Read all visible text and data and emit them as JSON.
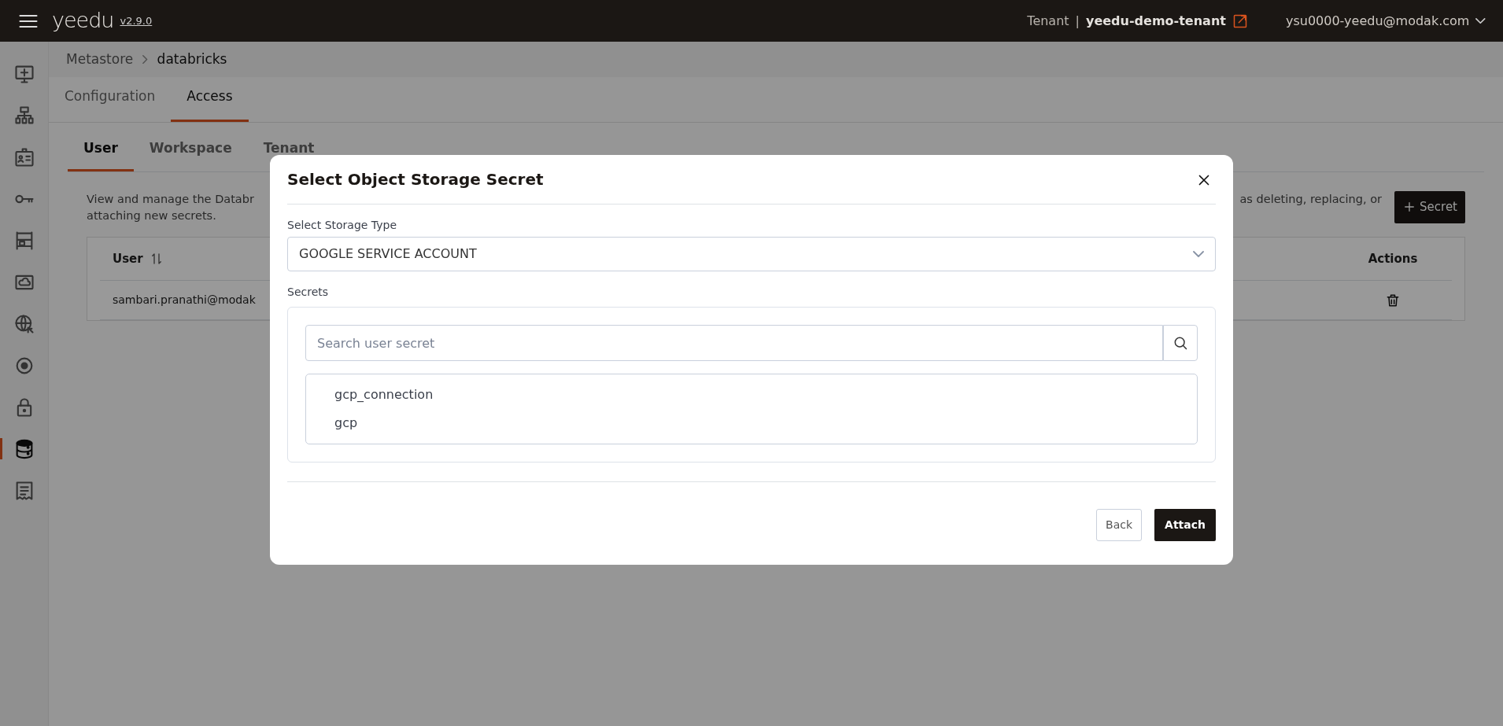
{
  "topbar": {
    "logo": "yeedu",
    "version": "v2.9.0",
    "tenant_label": "Tenant",
    "separator": "|",
    "tenant": "yeedu-demo-tenant",
    "user": "ysu0000-yeedu@modak.com"
  },
  "sidebar": {
    "items": [
      {
        "selected": false
      },
      {
        "selected": false
      },
      {
        "selected": false
      },
      {
        "selected": false
      },
      {
        "selected": false
      },
      {
        "selected": false
      },
      {
        "selected": false
      },
      {
        "selected": false
      },
      {
        "selected": false
      },
      {
        "selected": true
      },
      {
        "selected": false
      }
    ]
  },
  "breadcrumb": [
    "Metastore",
    "databricks"
  ],
  "tabs": [
    {
      "label": "Configuration",
      "selected": false
    },
    {
      "label": "Access",
      "selected": true
    }
  ],
  "subtabs": [
    {
      "label": "User",
      "selected": true
    },
    {
      "label": "Workspace",
      "selected": false
    },
    {
      "label": "Tenant",
      "selected": false
    }
  ],
  "description": {
    "lines": [
      "View and manage the Databr",
      "attaching new secrets."
    ],
    "right_text": "as deleting, replacing, or"
  },
  "add_button": "Secret",
  "table": {
    "columns": [
      {
        "label": "User",
        "sortable": true
      },
      {
        "label": "Actions",
        "sortable": false
      }
    ],
    "rows": [
      {
        "user": "sambari.pranathi@modak"
      }
    ]
  },
  "modal": {
    "title": "Select Object Storage Secret",
    "storage_type": {
      "label": "Select Storage Type",
      "value": "GOOGLE SERVICE ACCOUNT"
    },
    "secrets": {
      "label": "Secrets",
      "search_placeholder": "Search user secret",
      "items": [
        "gcp_connection",
        "gcp"
      ]
    },
    "buttons": [
      {
        "label": "Back",
        "kind": "secondary"
      },
      {
        "label": "Attach",
        "kind": "primary"
      }
    ]
  }
}
